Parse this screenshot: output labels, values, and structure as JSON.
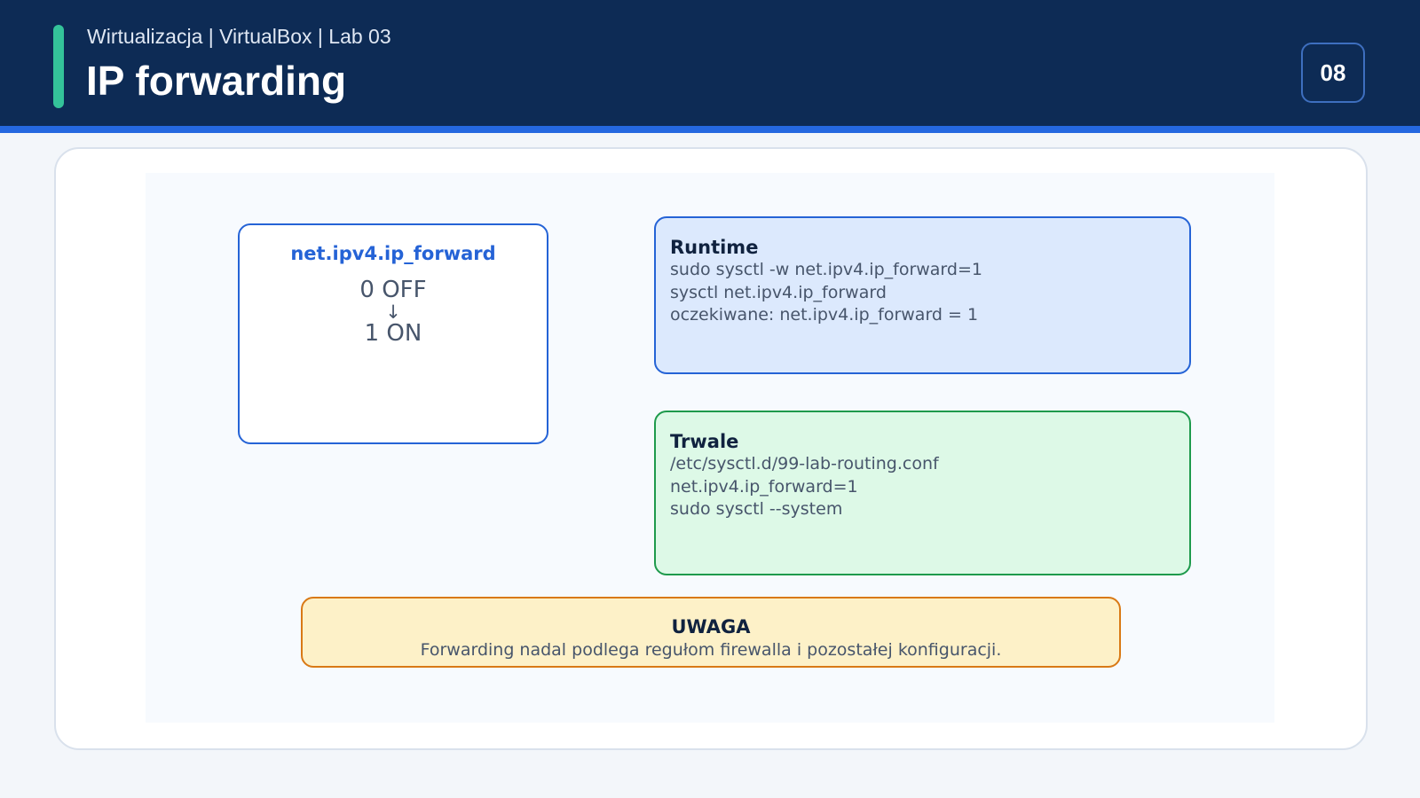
{
  "header": {
    "subtitle": "Wirtualizacja | VirtualBox | Lab 03",
    "title": "IP forwarding",
    "page_number": "08"
  },
  "colors": {
    "header_bg": "#0d2b55",
    "header_rule": "#2568e0",
    "accent": "#34c39a",
    "blue": "#2563d6",
    "green": "#1e9a4c",
    "orange": "#d97915"
  },
  "diagram": {
    "forward_box": {
      "title": "net.ipv4.ip_forward",
      "state_off": "0  OFF",
      "arrow": "↓",
      "state_on": "1  ON"
    },
    "runtime_box": {
      "heading": "Runtime",
      "lines": [
        "sudo sysctl -w net.ipv4.ip_forward=1",
        "sysctl net.ipv4.ip_forward",
        "oczekiwane: net.ipv4.ip_forward = 1"
      ]
    },
    "persistent_box": {
      "heading": "Trwale",
      "lines": [
        "/etc/sysctl.d/99-lab-routing.conf",
        "net.ipv4.ip_forward=1",
        "sudo sysctl --system"
      ]
    },
    "warning_box": {
      "heading": "UWAGA",
      "text": "Forwarding nadal podlega regułom firewalla i pozostałej konfiguracji."
    }
  }
}
